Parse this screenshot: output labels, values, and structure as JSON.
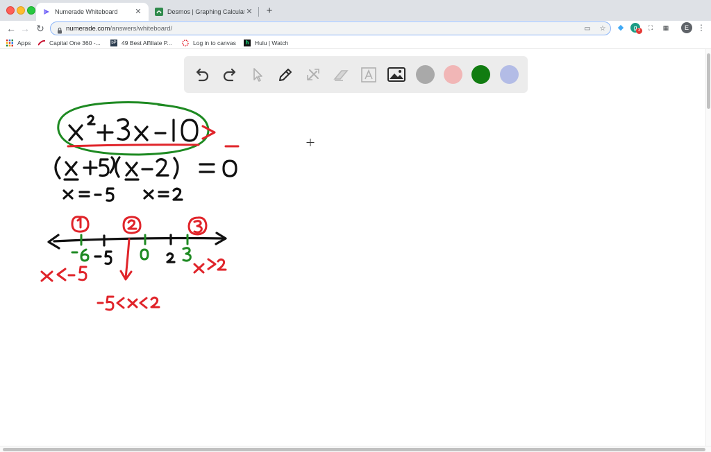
{
  "browser": {
    "tabs": [
      {
        "title": "Numerade Whiteboard",
        "active": true,
        "icon": "numerade-favicon"
      },
      {
        "title": "Desmos | Graphing Calculator",
        "active": false,
        "icon": "desmos-favicon"
      }
    ],
    "url_host": "numerade.com",
    "url_path": "/answers/whiteboard/",
    "profile_initial": "E",
    "extension_badge": "3",
    "bookmarks": [
      {
        "label": "Apps",
        "icon": "apps-grid-icon"
      },
      {
        "label": "Capital One 360 -...",
        "icon": "capital-one-icon"
      },
      {
        "label": "49 Best Affiliate P...",
        "icon": "bp-icon"
      },
      {
        "label": "Log in to canvas",
        "icon": "canvas-icon"
      },
      {
        "label": "Hulu | Watch",
        "icon": "hulu-icon"
      }
    ]
  },
  "whiteboard": {
    "tools": [
      "undo-icon",
      "redo-icon",
      "pointer-icon",
      "pen-icon",
      "tools-icon",
      "eraser-icon",
      "text-icon",
      "image-icon"
    ],
    "colors": [
      {
        "name": "gray",
        "hex": "#a9a9a9"
      },
      {
        "name": "pink",
        "hex": "#f1b6b6"
      },
      {
        "name": "green",
        "hex": "#117c11"
      },
      {
        "name": "lavender",
        "hex": "#b3bce6"
      }
    ],
    "ink": {
      "black": "#111111",
      "red": "#e0242a",
      "green": "#1e8a22"
    },
    "handwriting": {
      "equation": "x² + 3x − 10 = 0",
      "factored": "(x + 5)(x − 2) = 0",
      "root1": "x = -5",
      "root2": "x = 2",
      "region_labels": [
        "1",
        "2",
        "3"
      ],
      "ticks": [
        "-6",
        "-5",
        "0",
        "2",
        "3"
      ],
      "interval1": "x < -5",
      "interval2": "-5 < x < 2",
      "interval3": "x > 2"
    }
  }
}
